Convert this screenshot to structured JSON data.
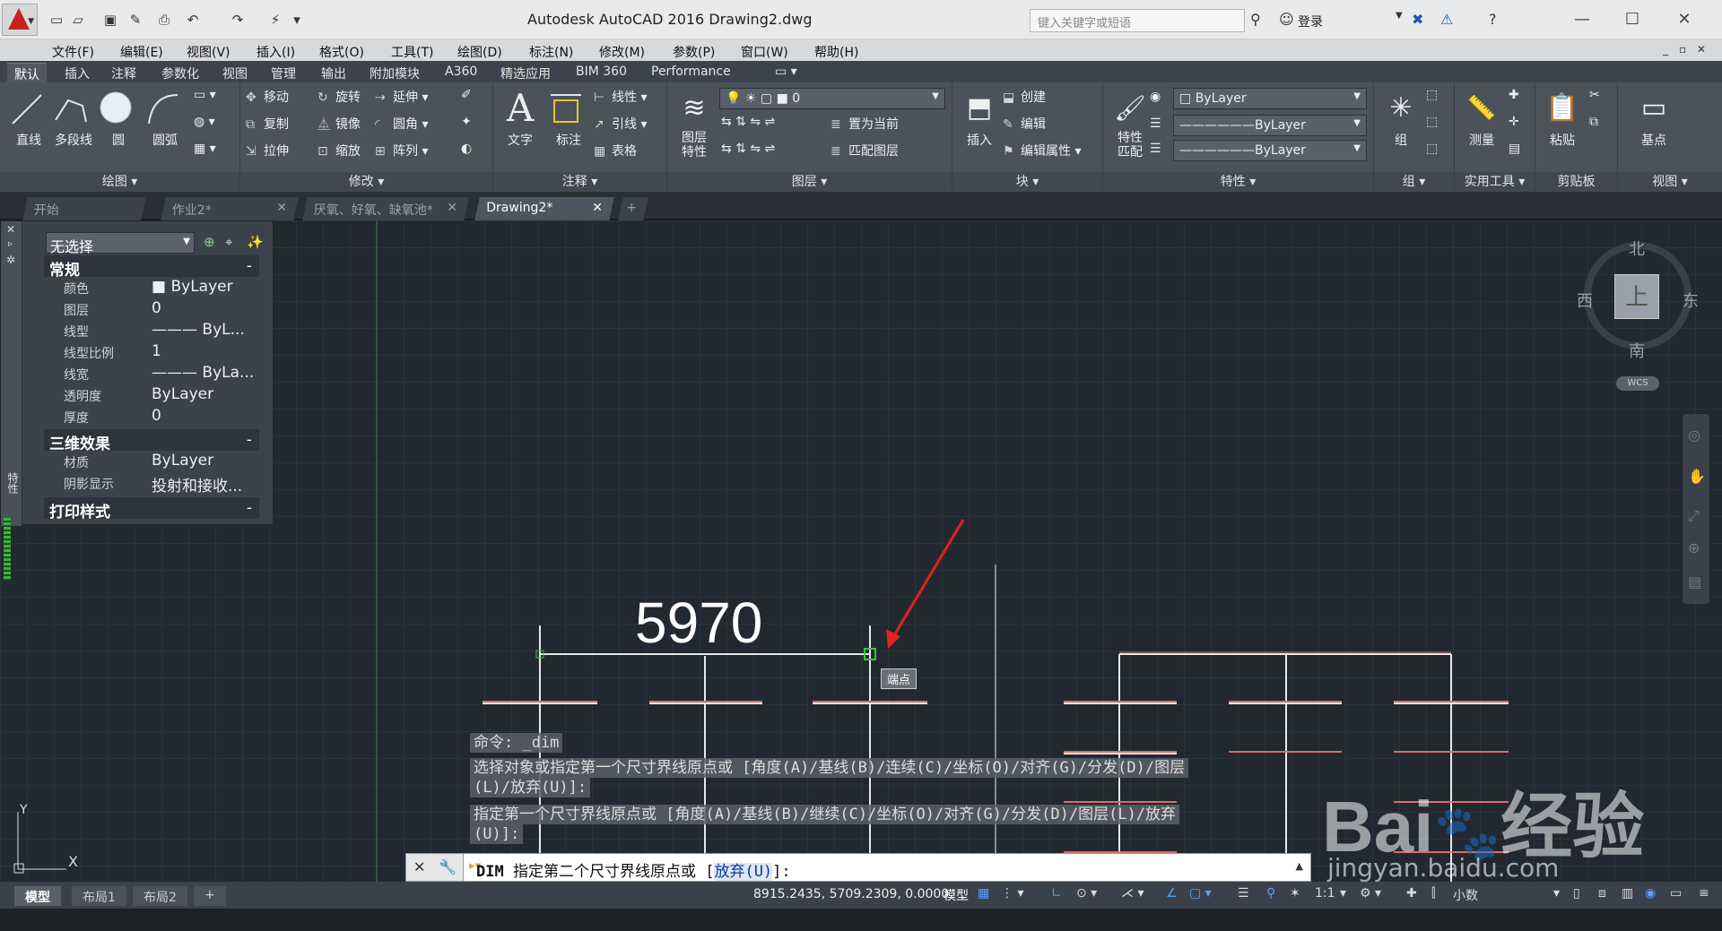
{
  "titlebar": {
    "title": "Autodesk AutoCAD 2016    Drawing2.dwg",
    "search_placeholder": "键入关键字或短语",
    "login": "登录"
  },
  "menu": [
    "文件(F)",
    "编辑(E)",
    "视图(V)",
    "插入(I)",
    "格式(O)",
    "工具(T)",
    "绘图(D)",
    "标注(N)",
    "修改(M)",
    "参数(P)",
    "窗口(W)",
    "帮助(H)"
  ],
  "ribbon_tabs": [
    "默认",
    "插入",
    "注释",
    "参数化",
    "视图",
    "管理",
    "输出",
    "附加模块",
    "A360",
    "精选应用",
    "BIM 360",
    "Performance"
  ],
  "ribbon": {
    "draw": {
      "title": "绘图 ▾",
      "line": "直线",
      "polyline": "多段线",
      "circle": "圆",
      "arc": "圆弧"
    },
    "modify": {
      "title": "修改 ▾",
      "move": "移动",
      "rotate": "旋转",
      "trim": "延伸",
      "copy": "复制",
      "mirror": "镜像",
      "fillet": "圆角",
      "stretch": "拉伸",
      "scale": "缩放",
      "array": "阵列"
    },
    "annotation": {
      "title": "注释 ▾",
      "text": "文字",
      "dimension": "标注",
      "linear": "线性",
      "leader": "引线",
      "table": "表格"
    },
    "layers": {
      "title": "图层 ▾",
      "layer_props": "图层\n特性",
      "current_layer": "0",
      "set_current": "置为当前",
      "match_layer": "匹配图层"
    },
    "block": {
      "title": "块 ▾",
      "insert": "插入",
      "create": "创建",
      "edit": "编辑",
      "edit_attr": "编辑属性"
    },
    "properties": {
      "title": "特性 ▾",
      "match": "特性\n匹配",
      "color": "ByLayer",
      "linetype": "ByLayer",
      "lineweight": "ByLayer"
    },
    "groups": {
      "title": "组 ▾",
      "group": "组"
    },
    "utilities": {
      "title": "实用工具 ▾",
      "measure": "测量"
    },
    "clipboard": {
      "title": "剪贴板",
      "paste": "粘贴"
    },
    "view": {
      "title": "视图 ▾",
      "base": "基点"
    }
  },
  "doc_tabs": [
    "开始",
    "作业2*",
    "厌氧、好氧、缺氧池*",
    "Drawing2*"
  ],
  "properties_palette": {
    "selection": "无选择",
    "sections": {
      "general": "常规",
      "effects3d": "三维效果",
      "plot": "打印样式"
    },
    "general_rows": [
      {
        "label": "颜色",
        "value": "■ ByLayer"
      },
      {
        "label": "图层",
        "value": "0"
      },
      {
        "label": "线型",
        "value": "——— ByL..."
      },
      {
        "label": "线型比例",
        "value": "1"
      },
      {
        "label": "线宽",
        "value": "——— ByLa..."
      },
      {
        "label": "透明度",
        "value": "ByLayer"
      },
      {
        "label": "厚度",
        "value": "0"
      }
    ],
    "effects_rows": [
      {
        "label": "材质",
        "value": "ByLayer"
      },
      {
        "label": "阴影显示",
        "value": "投射和接收..."
      }
    ],
    "side_label": "特性"
  },
  "drawing": {
    "dimension_text": "5970",
    "snap_tooltip": "端点",
    "ucs_x": "X",
    "ucs_y": "Y"
  },
  "command_history": [
    "命令: _dim",
    "选择对象或指定第一个尺寸界线原点或 [角度(A)/基线(B)/连续(C)/坐标(O)/对齐(G)/分发(D)/图层",
    "(L)/放弃(U)]:",
    "指定第一个尺寸界线原点或 [角度(A)/基线(B)/继续(C)/坐标(O)/对齐(G)/分发(D)/图层(L)/放弃",
    "(U)]:"
  ],
  "command_line": {
    "command": "DIM",
    "prompt": "指定第二个尺寸界线原点或 [",
    "option": "放弃(U)",
    "suffix": "]:"
  },
  "viewcube": {
    "north": "北",
    "south": "南",
    "east": "东",
    "west": "西",
    "face": "上",
    "wcs": "WCS"
  },
  "layout_tabs": [
    "模型",
    "布局1",
    "布局2"
  ],
  "status": {
    "coords": "8915.2435, 5709.2309, 0.0000",
    "model": "模型",
    "scale": "1:1",
    "units": "小数"
  },
  "watermark": "Baidu经验 jingyan.baidu.com",
  "colors": {
    "accent": "#c8221c",
    "canvas": "#212830",
    "ribbon": "#4b525a",
    "dim_line": "#e8e8e8",
    "red_line": "#e06a6a",
    "arrow": "#e0231f"
  }
}
